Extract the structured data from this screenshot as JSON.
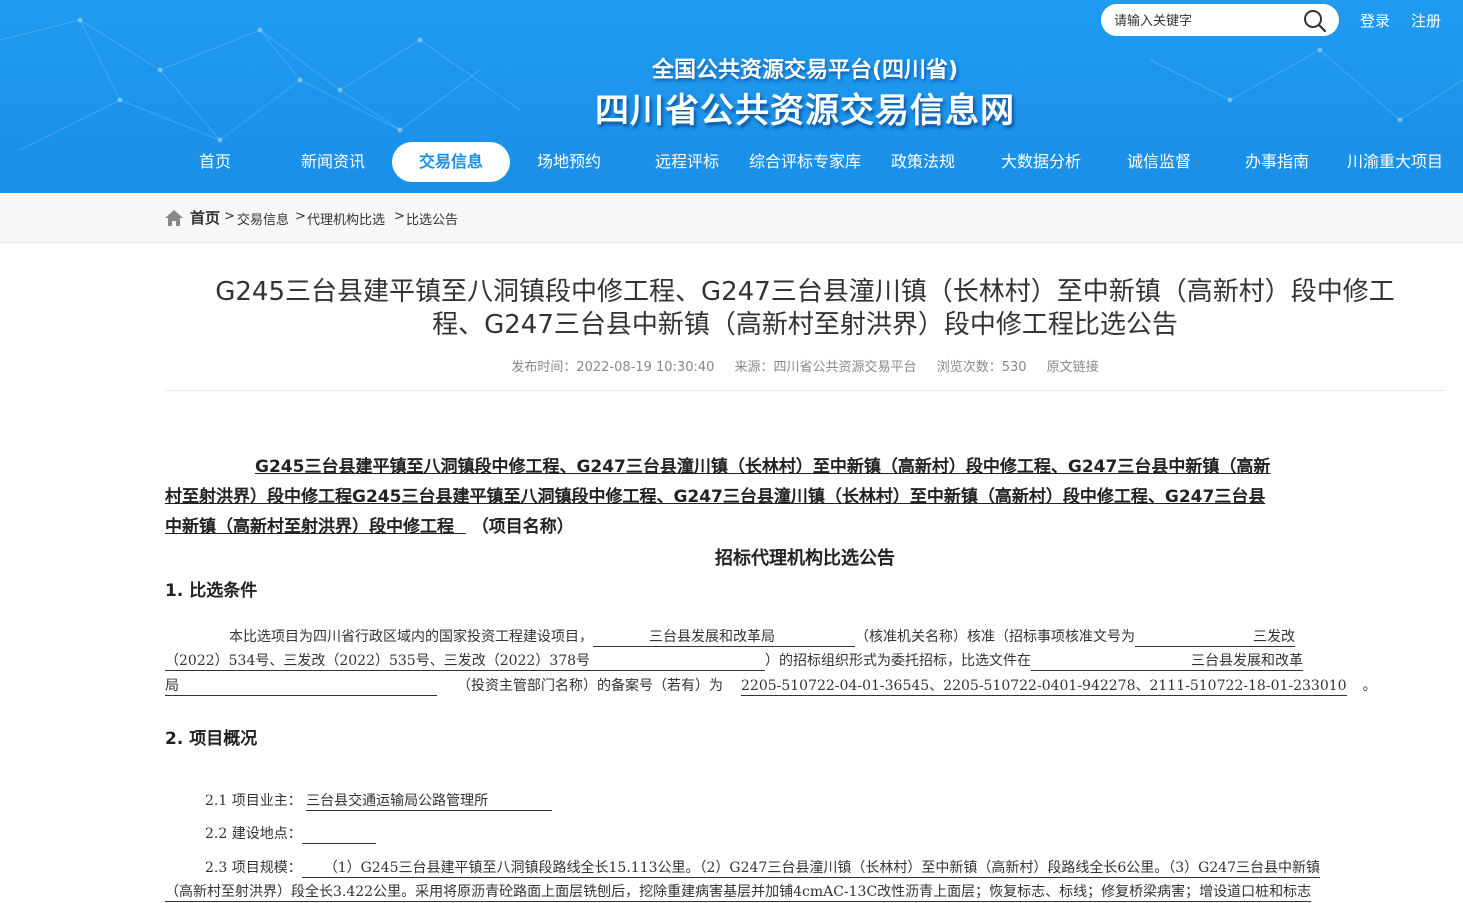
{
  "header": {
    "site_subtitle": "全国公共资源交易平台(四川省)",
    "site_title": "四川省公共资源交易信息网",
    "search_placeholder": "请输入关键字",
    "login": "登录",
    "register": "注册",
    "bg_color": "#1f9bf0"
  },
  "nav": {
    "items": [
      "首页",
      "新闻资讯",
      "交易信息",
      "场地预约",
      "远程评标",
      "综合评标专家库",
      "政策法规",
      "大数据分析",
      "诚信监督",
      "办事指南",
      "川渝重大项目"
    ],
    "active_index": 2
  },
  "breadcrumb": {
    "home": "首页",
    "items": [
      "交易信息",
      "代理机构比选",
      "比选公告"
    ]
  },
  "article": {
    "title_line1": "G245三台县建平镇至八洞镇段中修工程、G247三台县潼川镇（长林村）至中新镇（高新村）段中修工",
    "title_line2": "程、G247三台县中新镇（高新村至射洪界）段中修工程比选公告",
    "meta": {
      "publish_time": "发布时间：2022-08-19 10:30:40",
      "source": "来源：四川省公共资源交易平台",
      "views": "浏览次数：530",
      "original_link": "原文链接"
    },
    "project_name_line1": "G245三台县建平镇至八洞镇段中修工程、G247三台县潼川镇（长林村）至中新镇（高新村）段中修工程、G247三台县中新镇（高新",
    "project_name_line2": "村至射洪界）段中修工程G245三台县建平镇至八洞镇段中修工程、G247三台县潼川镇（长林村）至中新镇（高新村）段中修工程、G247三台县",
    "project_name_line3": "中新镇（高新村至射洪界）段中修工程",
    "project_name_suffix": "（项目名称）",
    "notice_title": "招标代理机构比选公告",
    "section1_title": "1.  比选条件",
    "s1_l1_a": "本比选项目为四川省行政区域内的国家投资工程建设项目，",
    "s1_l1_fill1": "三台县发展和改革局",
    "s1_l1_b": "（核准机关名称）核准（招标事项核准文号为",
    "s1_l1_fill2": "三发改",
    "s1_l2_fill": "（2022）534号、三发改（2022）535号、三发改（2022）378号",
    "s1_l2_b": "）的招标组织形式为委托招标，比选文件在",
    "s1_l2_fill2": "三台县发展和改革",
    "s1_l3_fill": "局",
    "s1_l3_b": "（投资主管部门名称）的备案号（若有）为",
    "s1_l3_fill2": "2205-510722-04-01-36545、2205-510722-0401-942278、2111-510722-18-01-233010",
    "s1_l3_end": "。",
    "section2_title": "2.  项目概况",
    "s21_label": "2.1 项目业主：",
    "s21_value": "三台县交通运输局公路管理所",
    "s22_label": "2.2 建设地点：",
    "s23_label": "2.3 项目规模：",
    "s23_line1": "（1）G245三台县建平镇至八洞镇段路线全长15.113公里。（2）G247三台县潼川镇（长林村）至中新镇（高新村）段路线全长6公里。（3）G247三台县中新镇",
    "s23_line2": "（高新村至射洪界）段全长3.422公里。采用将原沥青砼路面上面层铣刨后，挖除重建病害基层并加铺4cmAC-13C改性沥青上面层；恢复标志、标线；修复桥梁病害；增设道口桩和标志"
  }
}
